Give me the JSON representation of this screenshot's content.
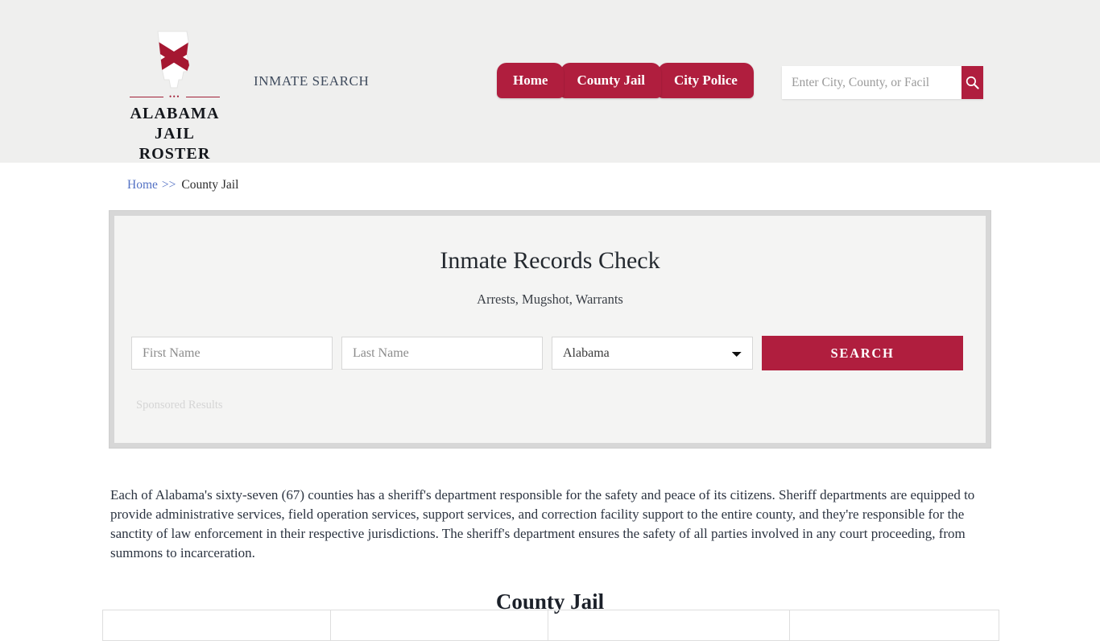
{
  "header": {
    "brand": {
      "line1": "ALABAMA",
      "line2": "JAIL ROSTER",
      "dots": "•••",
      "icon": "alabama-state-flag-logo"
    },
    "tagline": "INMATE SEARCH",
    "nav": [
      {
        "label": "Home"
      },
      {
        "label": "County Jail"
      },
      {
        "label": "City Police"
      }
    ],
    "search": {
      "placeholder": "Enter City, County, or Facil",
      "value": "",
      "button_icon": "search-icon"
    }
  },
  "breadcrumb": {
    "home": "Home",
    "separator": ">>",
    "current": "County Jail"
  },
  "search_card": {
    "title": "Inmate Records Check",
    "subtitle": "Arrests, Mugshot, Warrants",
    "first_name_placeholder": "First Name",
    "first_name_value": "",
    "last_name_placeholder": "Last Name",
    "last_name_value": "",
    "state_selected": "Alabama",
    "state_options": [
      "Alabama"
    ],
    "search_label": "SEARCH",
    "sponsored_label": "Sponsored Results"
  },
  "content": {
    "paragraph": "Each of Alabama's sixty-seven (67) counties has a sheriff's department responsible for the safety and peace of its citizens. Sheriff departments are equipped to provide administrative services, field operation services, support services, and correction facility support to the entire county, and they're responsible for the sanctity of law enforcement in their respective jurisdictions. The sheriff's department ensures the safety of all parties involved in any court proceeding, from summons to incarceration.",
    "section_heading": "County Jail"
  },
  "county_table": {
    "row": [
      "",
      "",
      "",
      ""
    ]
  },
  "colors": {
    "brand_red": "#b01e3e",
    "header_bg": "#efefee",
    "card_bg": "#f4f4f3",
    "card_border": "#d7d7d7",
    "link_blue": "#5371c4",
    "text_dark": "#2b3340"
  }
}
